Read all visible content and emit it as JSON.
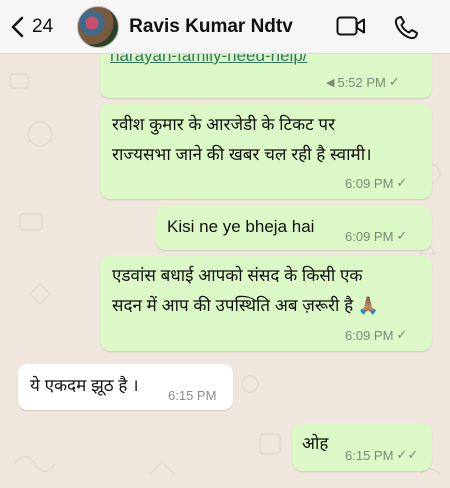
{
  "header": {
    "back_count": "24",
    "contact_name": "Ravis Kumar Ndtv"
  },
  "messages": [
    {
      "text": "narayan-family-need-help/",
      "time": "5:52 PM",
      "direction": "outgoing",
      "status": "read"
    },
    {
      "line1": "रवीश कुमार के आरजेडी के टिकट पर",
      "line2": "राज्यसभा जाने की खबर चल रही है स्वामी।",
      "time": "6:09 PM",
      "direction": "outgoing",
      "status": "delivered"
    },
    {
      "text": "Kisi ne ye bheja hai",
      "time": "6:09 PM",
      "direction": "outgoing",
      "status": "delivered"
    },
    {
      "line1": "एडवांस बधाई आपको संसद के किसी एक",
      "line2": "सदन में आप की उपस्थिति अब ज़रूरी है 🙏🏽",
      "time": "6:09 PM",
      "direction": "outgoing",
      "status": "delivered"
    },
    {
      "text": "ये एकदम झूठ है ।",
      "time": "6:15 PM",
      "direction": "incoming"
    },
    {
      "text": "ओह",
      "time": "6:15 PM",
      "direction": "outgoing",
      "status": "read"
    }
  ],
  "colors": {
    "outgoing_bubble": "#dbf8c6",
    "incoming_bubble": "#ffffff",
    "chat_background": "#efe7dd"
  }
}
